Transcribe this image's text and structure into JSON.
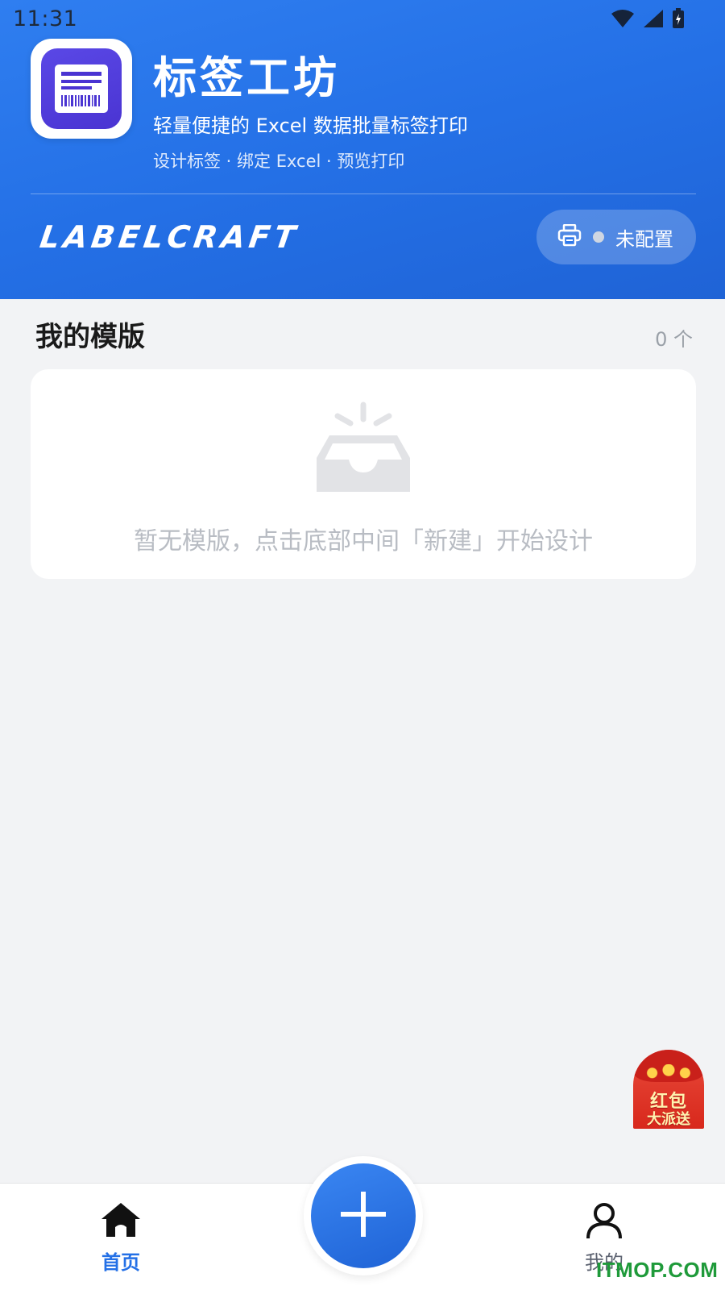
{
  "status_bar": {
    "time": "11:31"
  },
  "header": {
    "app_title": "标签工坊",
    "subtitle": "轻量便捷的 Excel 数据批量标签打印",
    "tagline": "设计标签 · 绑定 Excel · 预览打印",
    "brand": "LABELCRAFT",
    "printer_status": "未配置"
  },
  "templates": {
    "title": "我的模版",
    "count": "0 个",
    "empty_text": "暂无模版，点击底部中间「新建」开始设计"
  },
  "promo": {
    "line1": "红包",
    "line2": "大派送"
  },
  "bottom_nav": {
    "home_label": "首页",
    "mine_label": "我的"
  },
  "watermark": "ITMOP.COM",
  "colors": {
    "primary": "#2470e6",
    "header_top": "#2f7ef0",
    "page_bg": "#f2f3f5",
    "app_icon": "#5a48e6",
    "watermark": "#1f9a3a"
  },
  "icons": {
    "wifi": "wifi-icon",
    "signal": "signal-icon",
    "battery": "battery-icon",
    "printer": "printer-icon",
    "empty_inbox": "inbox-icon",
    "home": "home-icon",
    "add": "plus-icon",
    "user": "user-icon"
  }
}
